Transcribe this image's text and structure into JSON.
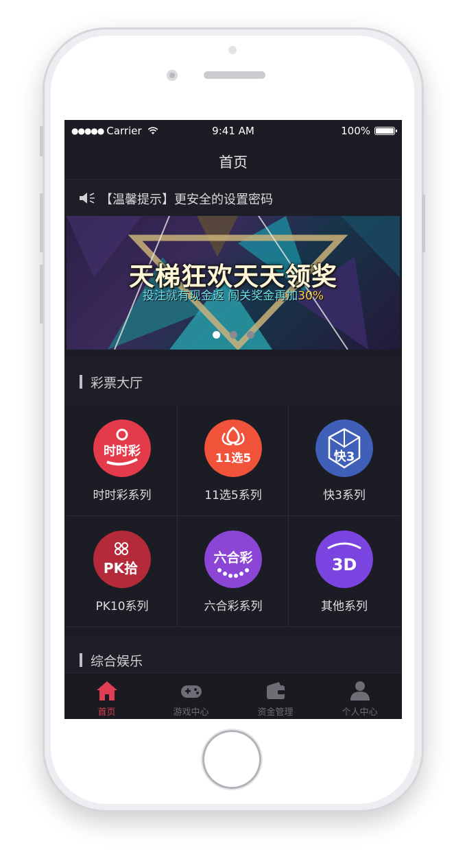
{
  "status_bar": {
    "carrier": "Carrier",
    "signal_dots": "●●●●●",
    "time": "9:41 AM",
    "battery": "100%"
  },
  "navbar": {
    "title": "首页"
  },
  "notice": {
    "text": "【温馨提示】更安全的设置密码",
    "icon": "speaker-icon"
  },
  "banner": {
    "headline": "天梯狂欢天天领奖",
    "subline_prefix": "投注就有现金返 闯关奖金再加",
    "subline_highlight": "30%",
    "pages": 3,
    "active_page": 1
  },
  "lottery_hall": {
    "title": "彩票大厅",
    "items": [
      {
        "label": "时时彩系列",
        "icon_text": "时时彩",
        "icon": "shishicai-icon",
        "color": "#e43b4b"
      },
      {
        "label": "11选5系列",
        "icon_text": "11选5",
        "icon": "11x5-icon",
        "color": "#f0523a"
      },
      {
        "label": "快3系列",
        "icon_text": "快3",
        "icon": "kuai3-icon",
        "color": "#3f5fb8"
      },
      {
        "label": "PK10系列",
        "icon_text": "PK拾",
        "icon": "pk10-icon",
        "color": "#b52a3b"
      },
      {
        "label": "六合彩系列",
        "icon_text": "六合彩",
        "icon": "liuhecai-icon",
        "color": "#8b46d6"
      },
      {
        "label": "其他系列",
        "icon_text": "3D",
        "icon": "3d-icon",
        "color": "#7a44e0"
      }
    ]
  },
  "entertainment": {
    "title": "综合娱乐"
  },
  "tabbar": {
    "items": [
      {
        "label": "首页",
        "icon": "home-icon",
        "active": true
      },
      {
        "label": "游戏中心",
        "icon": "gamepad-icon",
        "active": false
      },
      {
        "label": "资金管理",
        "icon": "wallet-icon",
        "active": false
      },
      {
        "label": "个人中心",
        "icon": "person-icon",
        "active": false
      }
    ],
    "active_color": "#e03e52",
    "inactive_color": "#6d6d76"
  }
}
